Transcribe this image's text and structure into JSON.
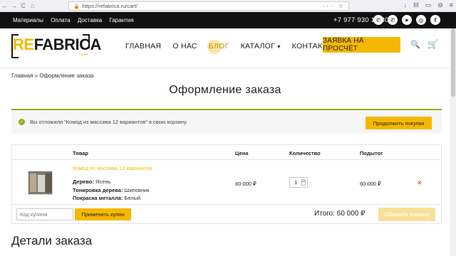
{
  "browser": {
    "url": "https://refabrica.ru/cart/",
    "controls": {
      "back": "←",
      "forward": "→",
      "reload": "C",
      "home": "⌂"
    },
    "address_right_icons": "··· ☆",
    "right_icons": {
      "download": "↓",
      "library": "III",
      "sidebar": "▭",
      "account": "⊖",
      "menu": "≡"
    }
  },
  "topbar": {
    "menu": [
      "Материалы",
      "Оплата",
      "Доставка",
      "Гарантия"
    ],
    "phone": "+7 977 930 10 80",
    "socials": [
      "whatsapp-icon",
      "viber-icon",
      "telegram-icon",
      "instagram-icon",
      "facebook-icon"
    ],
    "social_glyphs": [
      "✆",
      "✆",
      "➤",
      "◎",
      "f"
    ]
  },
  "header": {
    "logo_re": "RE",
    "logo_fab": "FABRICA",
    "logo_dots": "•••",
    "nav": [
      "ГЛАВНАЯ",
      "О НАС",
      "БЛОГ",
      "КАТАЛОГ",
      "КОНТАКТЫ"
    ],
    "catalog_arrow": "▾",
    "cta": "ЗАЯВКА НА ПРОСЧЁТ",
    "search_glyph": "🔍",
    "cart_glyph": "🛒"
  },
  "breadcrumb": "Главная » Оформление заказа",
  "page_title": "Оформление заказа",
  "notice": {
    "check": "✓",
    "text": "Вы отложили “Комод из массива 12 вариантов” в свою корзину.",
    "button": "Продолжить покупки"
  },
  "cart": {
    "headers": {
      "product": "Товар",
      "price": "Цена",
      "quantity": "Количество",
      "subtotal": "Подытог"
    },
    "item": {
      "name": "Комод из массива 12 вариантов",
      "attributes": [
        {
          "label": "Дерево:",
          "value": "Ясень"
        },
        {
          "label": "Тонировка дерева:",
          "value": "Шиповник"
        },
        {
          "label": "Покраска металла:",
          "value": "Белый"
        }
      ],
      "price": "60 000 ₽",
      "quantity": "1",
      "spin": "▴▾",
      "subtotal": "60 000 ₽",
      "remove": "✕"
    },
    "coupon_placeholder": "Код купона",
    "apply_button": "Применить купон",
    "total": "Итого: 60 000 ₽",
    "update_button": "Обновить корзину"
  },
  "details_title": "Детали заказа",
  "colors": {
    "accent": "#f5b800",
    "success": "#8fae1b",
    "topbar": "#111111"
  }
}
